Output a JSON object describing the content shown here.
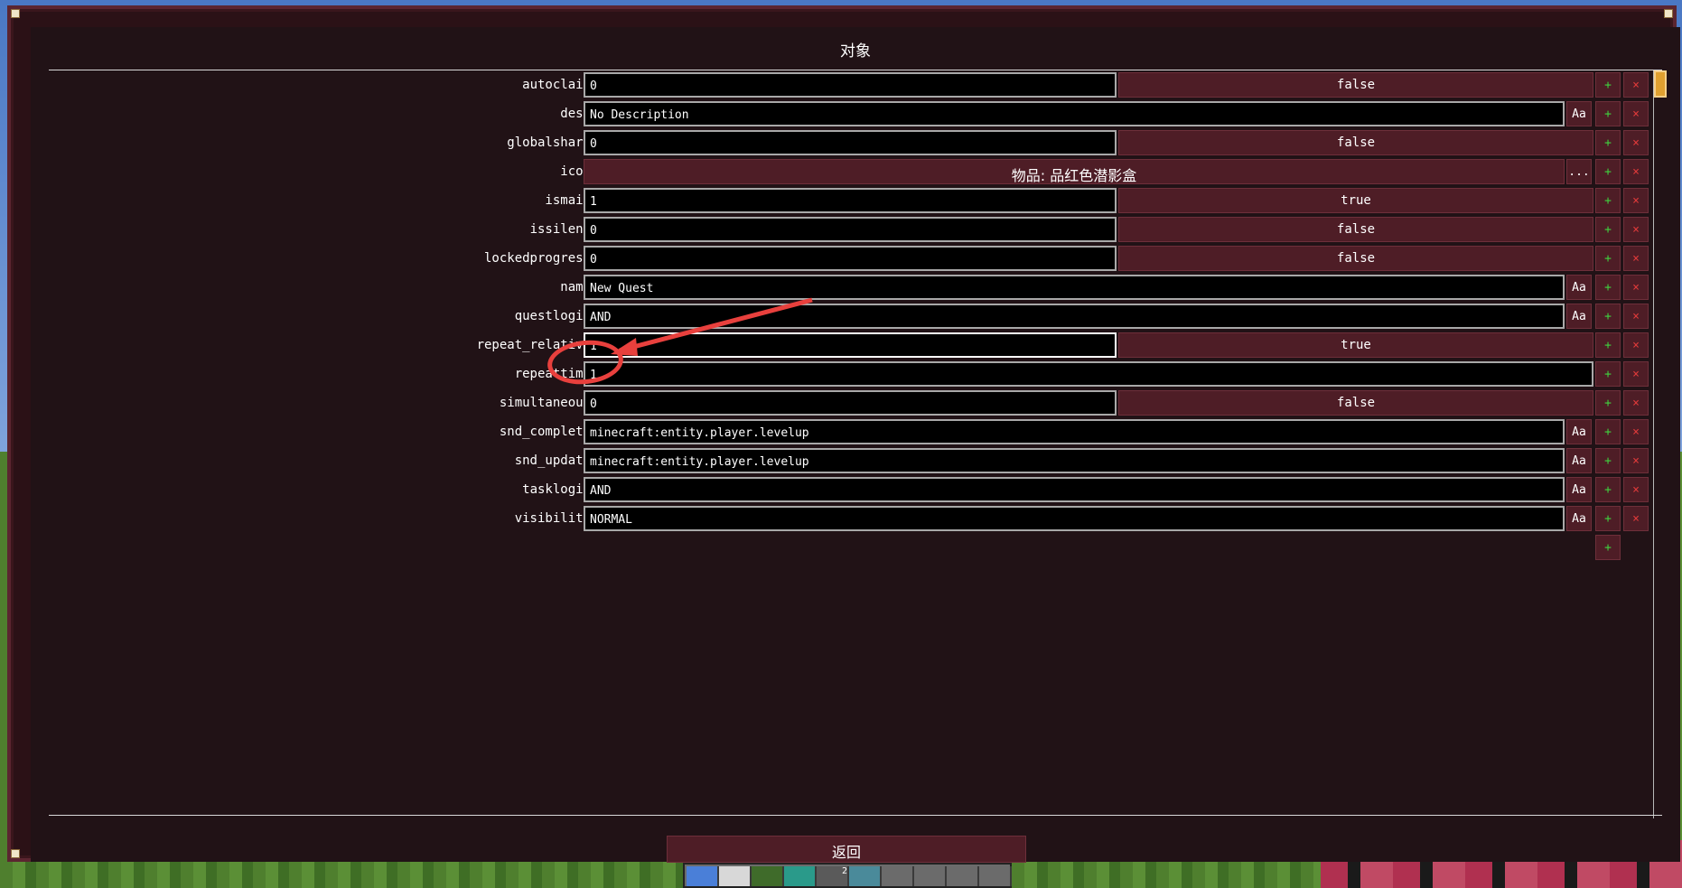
{
  "window": {
    "title": "对象"
  },
  "rows": [
    {
      "key": "autoclaim",
      "value": "0",
      "toggle": "false"
    },
    {
      "key": "desc",
      "value": "No Description",
      "aa": "Aa"
    },
    {
      "key": "globalshare",
      "value": "0",
      "toggle": "false"
    },
    {
      "key": "icon",
      "item": "物品: 品红色潜影盒",
      "more": "..."
    },
    {
      "key": "ismain",
      "value": "1",
      "toggle": "true"
    },
    {
      "key": "issilent",
      "value": "0",
      "toggle": "false"
    },
    {
      "key": "lockedprogress",
      "value": "0",
      "toggle": "false"
    },
    {
      "key": "name",
      "value": "New Quest",
      "aa": "Aa"
    },
    {
      "key": "questlogic",
      "value": "AND",
      "aa": "Aa"
    },
    {
      "key": "repeat_relative",
      "value": "1",
      "toggle": "true"
    },
    {
      "key": "repeattime",
      "value": "1"
    },
    {
      "key": "simultaneous",
      "value": "0",
      "toggle": "false"
    },
    {
      "key": "snd_complete",
      "value": "minecraft:entity.player.levelup",
      "aa": "Aa"
    },
    {
      "key": "snd_update",
      "value": "minecraft:entity.player.levelup",
      "aa": "Aa"
    },
    {
      "key": "tasklogic",
      "value": "AND",
      "aa": "Aa"
    },
    {
      "key": "visibility",
      "value": "NORMAL",
      "aa": "Aa"
    }
  ],
  "buttons": {
    "add": "+",
    "remove": "×",
    "back": "返回"
  },
  "hotbar": {
    "count_label": "2"
  },
  "colors": {
    "panel": "#211216",
    "button": "#4e1d26",
    "add": "#3fd43f",
    "remove": "#e03a3a",
    "annotation": "#e8403d"
  }
}
